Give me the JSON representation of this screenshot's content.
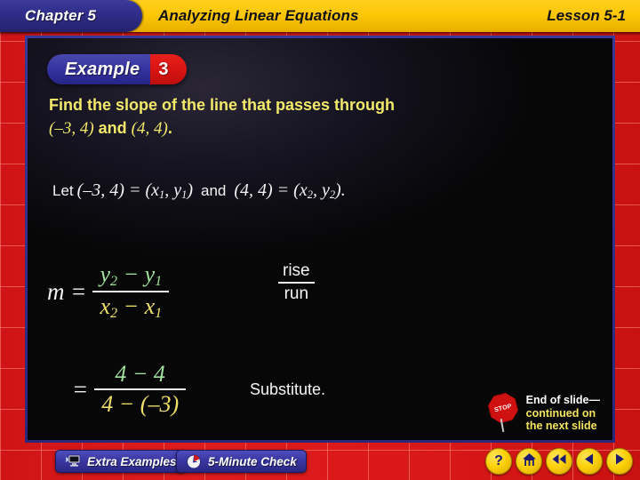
{
  "header": {
    "chapter_label": "Chapter 5",
    "title": "Analyzing Linear Equations",
    "lesson_label": "Lesson 5-1"
  },
  "example_badge": {
    "word": "Example",
    "number": "3"
  },
  "question": {
    "line1": "Find the slope of the line that passes through",
    "point1": "(–3, 4)",
    "conjunction": " and ",
    "point2": "(4, 4)",
    "period": "."
  },
  "let_line": {
    "let": "Let",
    "point1": "(–3, 4) = (",
    "x1": "x",
    "x1_sub": "1",
    "comma1": ", ",
    "y1": "y",
    "y1_sub": "1",
    "close1": ")",
    "and": "and",
    "point2": "(4, 4) = (",
    "x2": "x",
    "x2_sub": "2",
    "comma2": ", ",
    "y2": "y",
    "y2_sub": "2",
    "close2": ")."
  },
  "slope_formula": {
    "m": "m =",
    "numerator": {
      "y2": "y",
      "y2_sub": "2",
      "minus": " − ",
      "y1": "y",
      "y1_sub": "1"
    },
    "denominator": {
      "x2": "x",
      "x2_sub": "2",
      "minus": " − ",
      "x1": "x",
      "x1_sub": "1"
    }
  },
  "rise_run": {
    "numerator": "rise",
    "denominator": "run"
  },
  "substitution": {
    "equals": "=",
    "numerator": "4 − 4",
    "denominator": "4 − (–3)"
  },
  "substitute_label": "Substitute.",
  "end_note": {
    "line1": "End of slide—",
    "line2": "continued on",
    "line3": "the next slide",
    "sign_text": "STOP"
  },
  "toolbar": {
    "extra_examples": "Extra Examples",
    "five_minute_check": "5-Minute Check"
  },
  "nav": {
    "help": "?",
    "home": "⌂",
    "rewind": "◀◀",
    "previous": "◀",
    "next": "▶"
  },
  "colors": {
    "header_gold": "#fdc707",
    "chapter_blue": "#2e2c86",
    "frame_red": "#d81717",
    "question_yellow": "#f2e86a",
    "numerator_green": "#9fe39d",
    "denominator_yellow": "#efe06a",
    "panel_black": "#070708"
  }
}
